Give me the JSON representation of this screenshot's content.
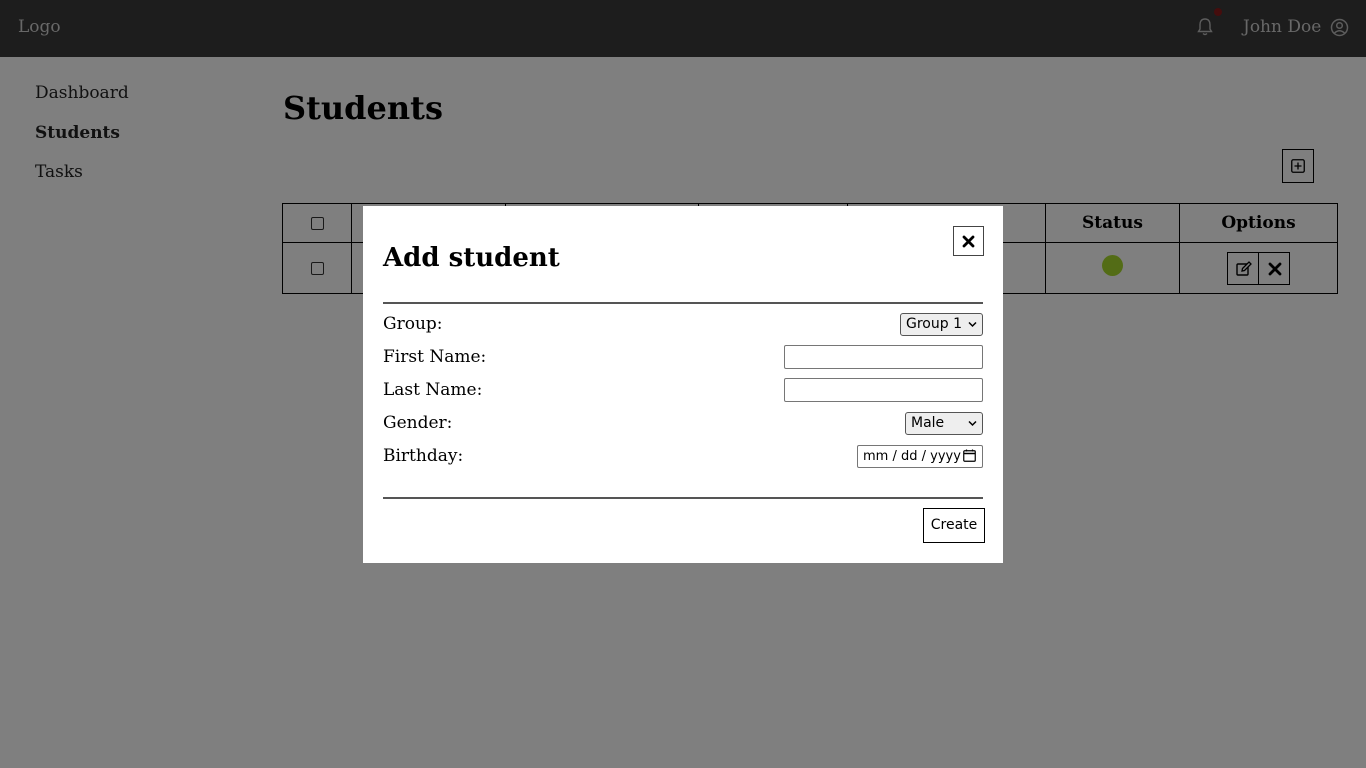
{
  "header": {
    "logo": "Logo",
    "user_name": "John Doe"
  },
  "sidebar": {
    "items": [
      {
        "label": "Dashboard",
        "active": false
      },
      {
        "label": "Students",
        "active": true
      },
      {
        "label": "Tasks",
        "active": false
      }
    ]
  },
  "main": {
    "title": "Students",
    "table": {
      "headers": [
        "",
        "",
        "",
        "",
        "",
        "Status",
        "Options"
      ],
      "rows": [
        {
          "status": "active"
        }
      ]
    }
  },
  "modal": {
    "title": "Add student",
    "fields": {
      "group": {
        "label": "Group:",
        "value": "Group 1"
      },
      "first_name": {
        "label": "First Name:",
        "value": ""
      },
      "last_name": {
        "label": "Last Name:",
        "value": ""
      },
      "gender": {
        "label": "Gender:",
        "value": "Male"
      },
      "birthday": {
        "label": "Birthday:",
        "placeholder": "mm / dd / yyyy"
      }
    },
    "create_label": "Create"
  },
  "colors": {
    "header_bg": "#3a3a3a",
    "status_active": "#a6d82c",
    "overlay": "rgba(0,0,0,0.5)"
  },
  "icons": [
    "bell-icon",
    "user-circle-icon",
    "plus-square-icon",
    "edit-icon",
    "close-icon",
    "chevron-down-icon",
    "calendar-icon"
  ]
}
